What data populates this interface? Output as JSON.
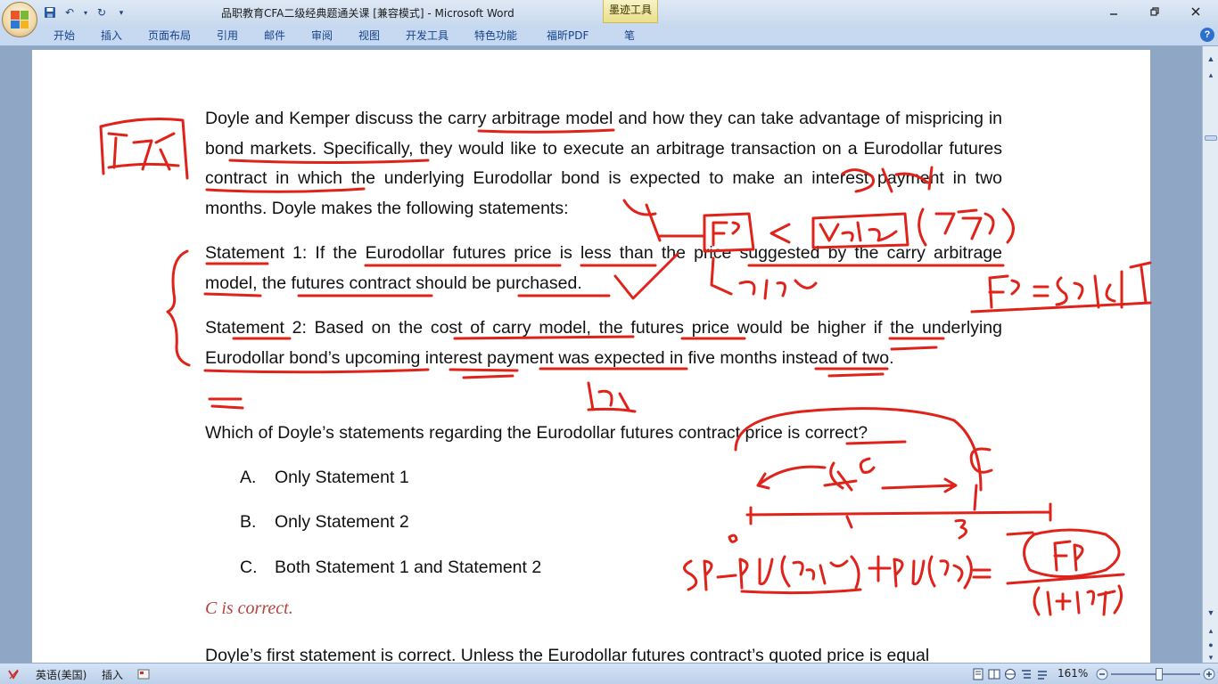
{
  "window": {
    "title": "品职教育CFA二级经典题通关课 [兼容模式] - Microsoft Word",
    "contextual_tab": "墨迹工具"
  },
  "ribbon": {
    "tabs": [
      "开始",
      "插入",
      "页面布局",
      "引用",
      "邮件",
      "审阅",
      "视图",
      "开发工具",
      "特色功能",
      "福昕PDF",
      "笔"
    ]
  },
  "document": {
    "para1": "Doyle and Kemper discuss the carry arbitrage model and how they can take advantage of mispricing in bond markets. Specifically, they would like to execute an arbitrage transaction on a Eurodollar futures contract in which the underlying Eurodollar bond is expected to make an interest payment in two months. Doyle makes the following statements:",
    "statement1": "Statement 1: If the Eurodollar futures price is less than the price suggested by the carry arbitrage model, the futures contract should be purchased.",
    "statement2": "Statement 2: Based on the cost of carry model, the futures price would be higher if the underlying Eurodollar bond’s upcoming interest payment was expected in five months instead of two.",
    "question": "Which of Doyle’s statements regarding the Eurodollar futures contract price is correct?",
    "options": [
      {
        "letter": "A.",
        "text": "Only Statement 1"
      },
      {
        "letter": "B.",
        "text": "Only Statement 2"
      },
      {
        "letter": "C.",
        "text": "Both Statement 1 and Statement 2"
      }
    ],
    "answer": "C is correct.",
    "explanation": "Doyle’s first statement is correct. Unless the Eurodollar futures contract’s quoted price is equal"
  },
  "status_bar": {
    "language": "英语(美国)",
    "mode": "插入",
    "zoom": "161%"
  },
  "colors": {
    "ink": "#e0231a",
    "answer": "#b5423c",
    "ribbon_text": "#15428b"
  }
}
